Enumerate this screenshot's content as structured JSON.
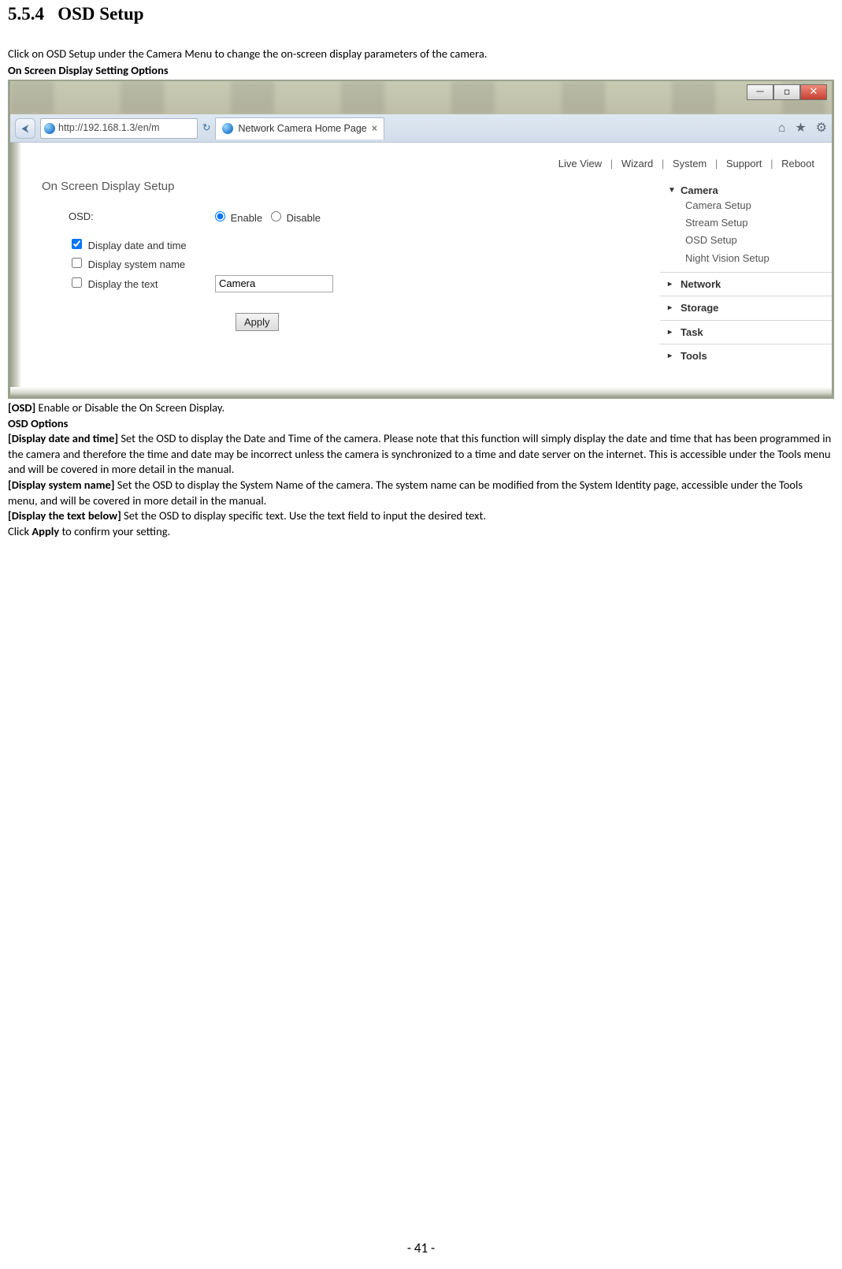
{
  "doc": {
    "section_number": "5.5.4",
    "section_title": "OSD Setup",
    "intro": "Click on OSD Setup under the Camera Menu to change the on-screen display parameters of the camera.",
    "caption_above": "On Screen Display Setting Options",
    "below_caption_bold": "[OSD]",
    "below_caption_rest": " Enable or Disable the On Screen Display.",
    "osd_options_heading": "OSD Options",
    "p1_bold": "[Display date and time]",
    "p1_rest": " Set the OSD to display the Date and Time of the camera. Please note that this function will simply display the date and time that has been programmed in the camera and therefore the time and date may be incorrect unless the camera is synchronized to a time and date server on the internet. This is accessible under the Tools menu and will be covered in more detail in the manual.",
    "p2_bold": "[Display system name]",
    "p2_rest": " Set the OSD to display the System Name of the camera. The system name can be modified from the System Identity page, accessible under the Tools menu, and will be covered in more detail in the manual.",
    "p3_bold": "[Display the text below]",
    "p3_rest": " Set the OSD to display specific text. Use the text field to input the desired text.",
    "p4_pre": "Click ",
    "p4_bold": "Apply",
    "p4_post": " to confirm your setting.",
    "page_number": "- 41 -"
  },
  "win": {
    "minimize_glyph": "—",
    "maximize_glyph": "□",
    "close_glyph": "✕"
  },
  "browser": {
    "back_glyph": "⮜",
    "url": "http://192.168.1.3/en/m",
    "refresh_glyph": "↻",
    "tab_title": "Network Camera Home Page",
    "tab_close": "×",
    "tool_home": "⌂",
    "tool_star": "★",
    "tool_gear": "⚙"
  },
  "topnav": {
    "items": [
      "Live View",
      "Wizard",
      "System",
      "Support",
      "Reboot"
    ]
  },
  "form": {
    "heading": "On Screen Display Setup",
    "osd_label": "OSD:",
    "enable_label": "Enable",
    "disable_label": "Disable",
    "osd_value": "enable",
    "cb1_label": "Display date and time",
    "cb1_checked": true,
    "cb2_label": "Display system name",
    "cb2_checked": false,
    "cb3_label": "Display the text",
    "cb3_checked": false,
    "text_value": "Camera",
    "apply_label": "Apply"
  },
  "side": {
    "camera": {
      "label": "Camera",
      "items": [
        "Camera Setup",
        "Stream Setup",
        "OSD Setup",
        "Night Vision Setup"
      ]
    },
    "network": "Network",
    "storage": "Storage",
    "task": "Task",
    "tools": "Tools"
  }
}
